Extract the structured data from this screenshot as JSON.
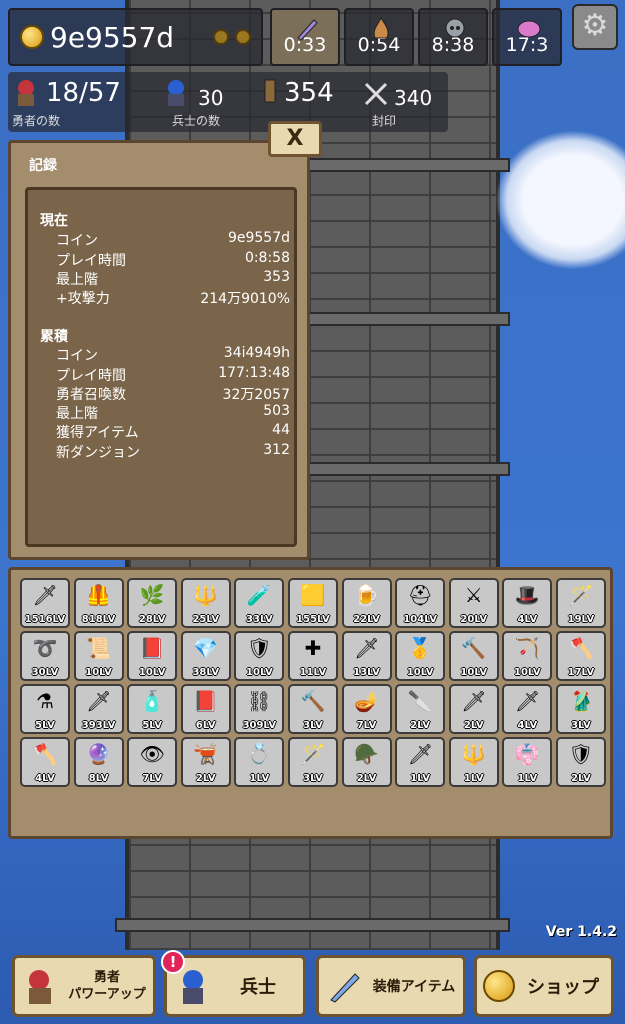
{
  "hud": {
    "coins": "9e9557d",
    "timers": [
      {
        "icon": "sword-timer-icon",
        "value": "0:33"
      },
      {
        "icon": "flame-timer-icon",
        "value": "0:54"
      },
      {
        "icon": "skull-timer-icon",
        "value": "8:38"
      },
      {
        "icon": "gem-timer-icon",
        "value": "17:3"
      }
    ]
  },
  "stats": {
    "heroes_value": "18/57",
    "heroes_label": "勇者の数",
    "soldiers_value": "30",
    "soldiers_label": "兵士の数",
    "tower_value": "354",
    "seal_value": "340",
    "seal_label": "封印"
  },
  "record": {
    "title": "記録",
    "close": "X",
    "current_title": "現在",
    "current": [
      {
        "label": "コイン",
        "value": "9e9557d"
      },
      {
        "label": "プレイ時間",
        "value": "0:8:58"
      },
      {
        "label": "最上階",
        "value": "353"
      },
      {
        "label": "+攻撃力",
        "value": "214万9010%"
      }
    ],
    "total_title": "累積",
    "total": [
      {
        "label": "コイン",
        "value": "34i4949h"
      },
      {
        "label": "プレイ時間",
        "value": "177:13:48"
      },
      {
        "label": "勇者召喚数",
        "value": "32万2057"
      },
      {
        "label": "最上階",
        "value": "503"
      },
      {
        "label": "獲得アイテム",
        "value": "44"
      },
      {
        "label": "新ダンジョン",
        "value": "312"
      }
    ]
  },
  "items": [
    {
      "icon": "lance-icon",
      "glyph": "🗡",
      "lv": "1516LV"
    },
    {
      "icon": "armor-icon",
      "glyph": "🦺",
      "lv": "818LV"
    },
    {
      "icon": "plant-icon",
      "glyph": "🌿",
      "lv": "28LV"
    },
    {
      "icon": "spear-icon",
      "glyph": "🔱",
      "lv": "25LV"
    },
    {
      "icon": "potion-icon",
      "glyph": "🧪",
      "lv": "33LV"
    },
    {
      "icon": "gold-block-icon",
      "glyph": "🟨",
      "lv": "155LV"
    },
    {
      "icon": "beer-icon",
      "glyph": "🍺",
      "lv": "22LV"
    },
    {
      "icon": "helmet-icon",
      "glyph": "⛑",
      "lv": "104LV"
    },
    {
      "icon": "sword-icon",
      "glyph": "⚔",
      "lv": "20LV"
    },
    {
      "icon": "hat-icon",
      "glyph": "🎩",
      "lv": "4LV"
    },
    {
      "icon": "staff-icon",
      "glyph": "🪄",
      "lv": "19LV"
    },
    {
      "icon": "whip-icon",
      "glyph": "➰",
      "lv": "30LV"
    },
    {
      "icon": "scroll-icon",
      "glyph": "📜",
      "lv": "10LV"
    },
    {
      "icon": "book-icon",
      "glyph": "📕",
      "lv": "10LV"
    },
    {
      "icon": "crystal-icon",
      "glyph": "💎",
      "lv": "38LV"
    },
    {
      "icon": "shield-icon",
      "glyph": "🛡",
      "lv": "10LV"
    },
    {
      "icon": "cross-icon",
      "glyph": "✚",
      "lv": "11LV"
    },
    {
      "icon": "dagger-icon",
      "glyph": "🗡",
      "lv": "13LV"
    },
    {
      "icon": "gold-armor-icon",
      "glyph": "🥇",
      "lv": "10LV"
    },
    {
      "icon": "mace-icon",
      "glyph": "🔨",
      "lv": "10LV"
    },
    {
      "icon": "bow-icon",
      "glyph": "🏹",
      "lv": "10LV"
    },
    {
      "icon": "axe-icon",
      "glyph": "🪓",
      "lv": "17LV"
    },
    {
      "icon": "flask-icon",
      "glyph": "⚗",
      "lv": "5LV"
    },
    {
      "icon": "katana-icon",
      "glyph": "🗡",
      "lv": "393LV"
    },
    {
      "icon": "bottle-icon",
      "glyph": "🧴",
      "lv": "5LV"
    },
    {
      "icon": "red-book-icon",
      "glyph": "📕",
      "lv": "6LV"
    },
    {
      "icon": "chainmail-icon",
      "glyph": "⛓",
      "lv": "309LV"
    },
    {
      "icon": "hammer-icon",
      "glyph": "🔨",
      "lv": "3LV"
    },
    {
      "icon": "lamp-icon",
      "glyph": "🪔",
      "lv": "7LV"
    },
    {
      "icon": "blade-icon",
      "glyph": "🔪",
      "lv": "2LV"
    },
    {
      "icon": "ice-sword-icon",
      "glyph": "🗡",
      "lv": "2LV"
    },
    {
      "icon": "purple-sword-icon",
      "glyph": "🗡",
      "lv": "4LV"
    },
    {
      "icon": "robe-icon",
      "glyph": "🥻",
      "lv": "3LV"
    },
    {
      "icon": "battle-axe-icon",
      "glyph": "🪓",
      "lv": "4LV"
    },
    {
      "icon": "orb-icon",
      "glyph": "🔮",
      "lv": "8LV"
    },
    {
      "icon": "eye-icon",
      "glyph": "👁",
      "lv": "7LV"
    },
    {
      "icon": "cauldron-icon",
      "glyph": "🫕",
      "lv": "2LV"
    },
    {
      "icon": "ring-icon",
      "glyph": "💍",
      "lv": "1LV"
    },
    {
      "icon": "scepter-icon",
      "glyph": "🪄",
      "lv": "3LV"
    },
    {
      "icon": "knight-helm-icon",
      "glyph": "🪖",
      "lv": "2LV"
    },
    {
      "icon": "green-sword-icon",
      "glyph": "🗡",
      "lv": "1LV"
    },
    {
      "icon": "red-spear-icon",
      "glyph": "🔱",
      "lv": "1LV"
    },
    {
      "icon": "pink-cloak-icon",
      "glyph": "👘",
      "lv": "1LV"
    },
    {
      "icon": "dark-armor-icon",
      "glyph": "🛡",
      "lv": "2LV"
    }
  ],
  "version": "Ver 1.4.2",
  "nav": {
    "hero_power_line1": "勇者",
    "hero_power_line2": "パワーアップ",
    "soldier": "兵士",
    "soldier_badge": "!",
    "equipment": "装備アイテム",
    "shop": "ショップ"
  }
}
